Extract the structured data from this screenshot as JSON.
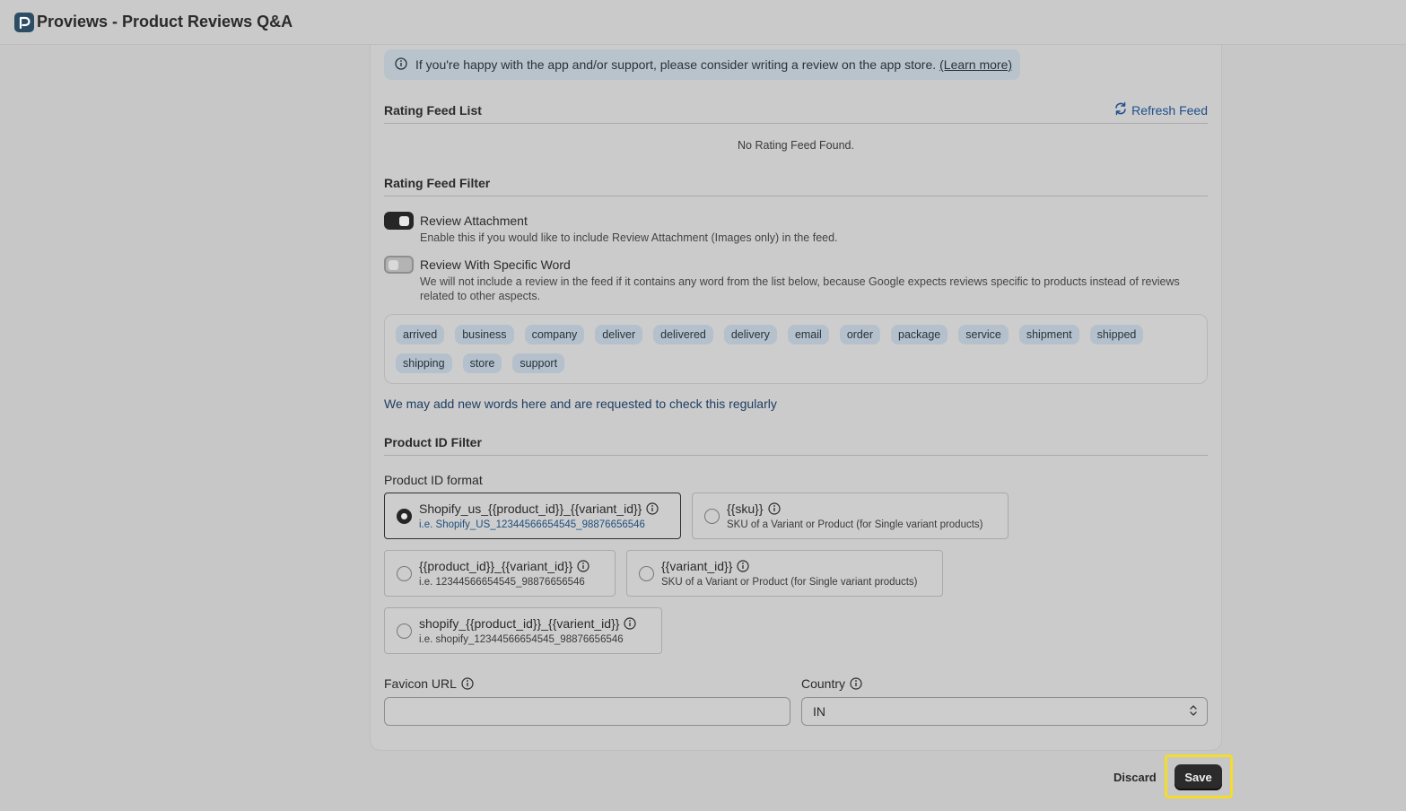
{
  "app": {
    "title": "Proviews - Product Reviews Q&A"
  },
  "banner": {
    "text": "If you're happy with the app and/or support, please consider writing a review on the app store.",
    "link": "(Learn more)"
  },
  "rating_feed_list": {
    "title": "Rating Feed List",
    "refresh_label": "Refresh Feed",
    "empty_text": "No Rating Feed Found."
  },
  "rating_feed_filter": {
    "title": "Rating Feed Filter",
    "toggles": [
      {
        "label": "Review Attachment",
        "description": "Enable this if you would like to include Review Attachment (Images only) in the feed.",
        "checked": true
      },
      {
        "label": "Review With Specific Word",
        "description": "We will not include a review in the feed if it contains any word from the list below, because Google expects reviews specific to products instead of reviews related to other aspects.",
        "checked": false
      }
    ],
    "words": [
      "arrived",
      "business",
      "company",
      "deliver",
      "delivered",
      "delivery",
      "email",
      "order",
      "package",
      "service",
      "shipment",
      "shipped",
      "shipping",
      "store",
      "support"
    ],
    "note": "We may add new words here and are requested to check this regularly"
  },
  "product_id_filter": {
    "title": "Product ID Filter",
    "format_label": "Product ID format",
    "options": [
      {
        "title": "Shopify_us_{{product_id}}_{{variant_id}}",
        "sub": "i.e. Shopify_US_12344566654545_98876656546",
        "selected": true
      },
      {
        "title": "{{sku}}",
        "sub": "SKU of a Variant or Product (for Single variant products)",
        "selected": false
      },
      {
        "title": "{{product_id}}_{{variant_id}}",
        "sub": "i.e. 12344566654545_98876656546",
        "selected": false
      },
      {
        "title": "{{variant_id}}",
        "sub": "SKU of a Variant or Product (for Single variant products)",
        "selected": false
      },
      {
        "title": "shopify_{{product_id}}_{{varient_id}}",
        "sub": "i.e. shopify_12344566654545_98876656546",
        "selected": false
      }
    ]
  },
  "fields": {
    "favicon_label": "Favicon URL",
    "favicon_value": "",
    "country_label": "Country",
    "country_value": "IN"
  },
  "footer": {
    "discard_label": "Discard",
    "save_label": "Save"
  },
  "colors": {
    "highlight": "#f4dc2a",
    "link": "#1e4f8c",
    "chip_bg": "#b4c0cb"
  }
}
